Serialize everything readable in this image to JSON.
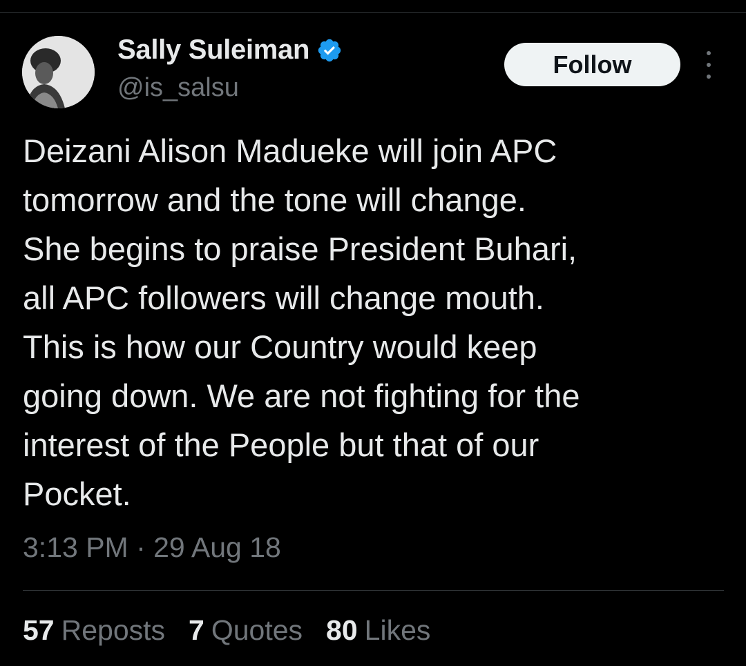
{
  "author": {
    "display_name": "Sally Suleiman",
    "handle": "@is_salsu",
    "verified_icon": "verified-badge-icon",
    "verified_color": "#1d9bf0"
  },
  "header": {
    "follow_label": "Follow",
    "more_icon": "more-vertical-icon"
  },
  "tweet": {
    "text": "Deizani Alison Madueke will join APC\ntomorrow and the tone will change.\nShe begins to praise President Buhari,\nall APC followers will change mouth.\nThis is how our Country would keep\ngoing down. We are not fighting for the\ninterest of the People but that of our\nPocket.",
    "timestamp": "3:13 PM · 29 Aug 18"
  },
  "stats": {
    "reposts_count": "57",
    "reposts_label": "Reposts",
    "quotes_count": "7",
    "quotes_label": "Quotes",
    "likes_count": "80",
    "likes_label": "Likes"
  },
  "colors": {
    "background": "#000000",
    "text_primary": "#e7e9ea",
    "text_secondary": "#71767b",
    "divider": "#2f3336",
    "follow_button_bg": "#eff3f4"
  }
}
